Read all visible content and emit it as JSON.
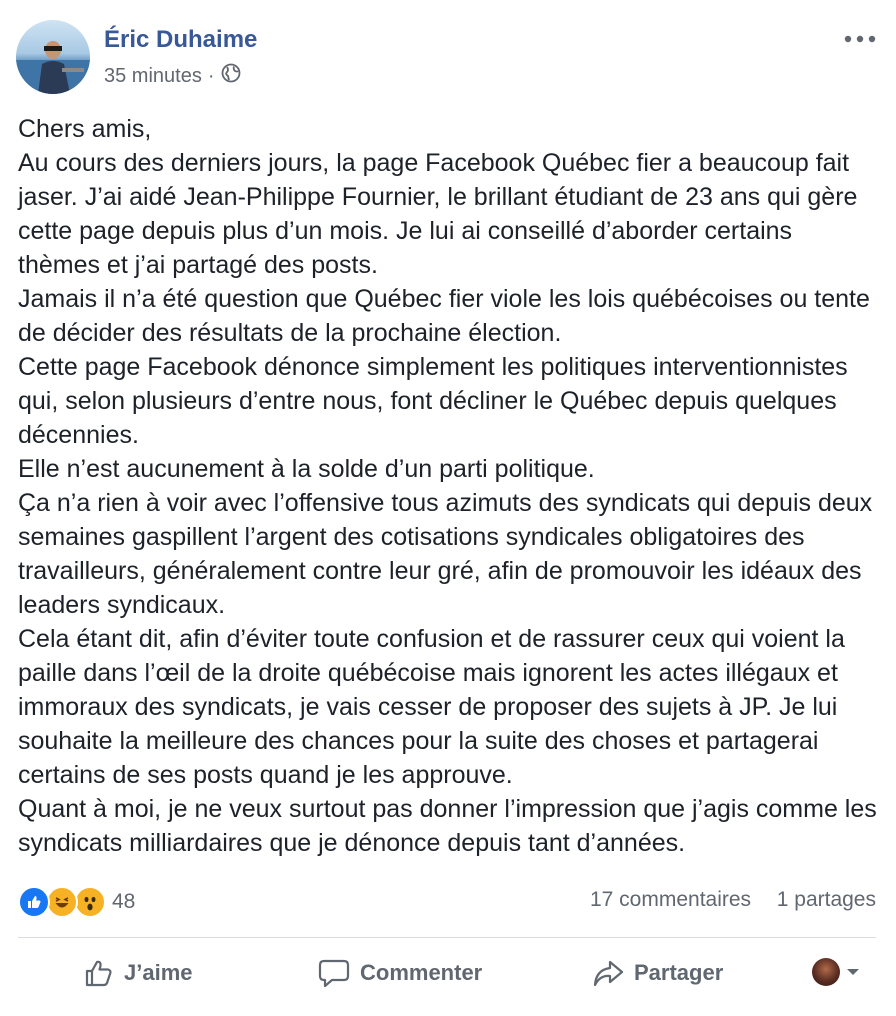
{
  "author": {
    "name": "Éric Duhaime",
    "timestamp": "35 minutes",
    "separator": "·",
    "privacy_icon": "globe-icon"
  },
  "post": {
    "paragraphs": [
      "Chers amis,",
      "Au cours des derniers jours, la page Facebook Québec fier a beaucoup fait jaser. J’ai aidé Jean-Philippe Fournier, le brillant étudiant de 23 ans qui gère cette page depuis plus d’un mois. Je lui ai conseillé d’aborder certains thèmes et j’ai partagé des posts.",
      "Jamais il n’a été question que Québec fier viole les lois québécoises ou tente de décider des résultats de la prochaine élection.",
      "Cette page Facebook dénonce simplement les politiques interventionnistes qui, selon plusieurs d’entre nous, font décliner le Québec depuis quelques décennies.",
      "Elle n’est aucunement à la solde d’un parti politique.",
      "Ça n’a rien à voir avec l’offensive tous azimuts des syndicats qui depuis deux semaines gaspillent l’argent des cotisations syndicales obligatoires des travailleurs, généralement contre leur gré, afin de promouvoir les idéaux des leaders syndicaux.",
      "Cela étant dit, afin d’éviter toute confusion et de rassurer ceux qui voient la paille dans l’œil de la droite québécoise mais ignorent les actes illégaux et immoraux des syndicats, je vais cesser de proposer des sujets à JP. Je lui souhaite la meilleure des chances pour la suite des choses et partagerai certains de ses posts quand je les approuve.",
      "Quant à moi, je ne veux surtout pas donner l’impression que j’agis comme les syndicats milliardaires que je dénonce depuis tant d’années."
    ]
  },
  "stats": {
    "reaction_icons": [
      "like-icon",
      "haha-icon",
      "wow-icon"
    ],
    "reaction_count": "48",
    "comments": "17 commentaires",
    "shares": "1 partages"
  },
  "actions": {
    "like": "J’aime",
    "comment": "Commenter",
    "share": "Partager"
  },
  "colors": {
    "name_blue": "#385898",
    "like_blue": "#1877f2",
    "emoji_yellow": "#f7b125",
    "meta_gray": "#616770"
  }
}
